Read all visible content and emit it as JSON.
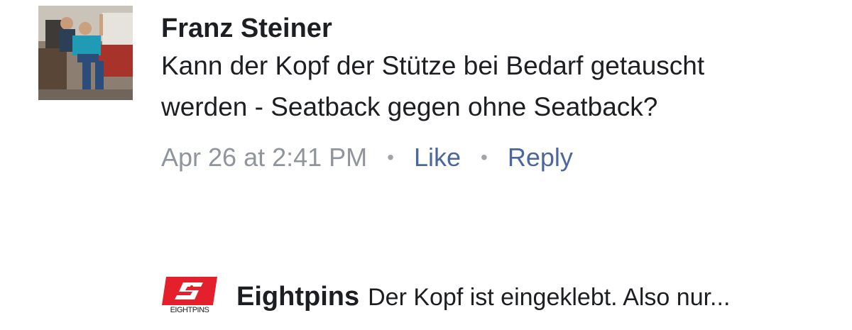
{
  "comment": {
    "author": "Franz Steiner",
    "text": "Kann der Kopf der Stütze bei Bedarf getauscht werden - Seatback gegen ohne Seatback?",
    "timestamp": "Apr 26 at 2:41 PM",
    "separator": "•",
    "like_label": "Like",
    "reply_label": "Reply",
    "avatar_icon": "user-photo"
  },
  "reply": {
    "author": "Eightpins",
    "preview": "Der Kopf ist eingeklebt. Also nur...",
    "logo_text": "EIGHTPINS",
    "brand_color": "#e3202b"
  },
  "colors": {
    "text": "#1c1e21",
    "meta": "#90949c",
    "link": "#4b67a1"
  }
}
